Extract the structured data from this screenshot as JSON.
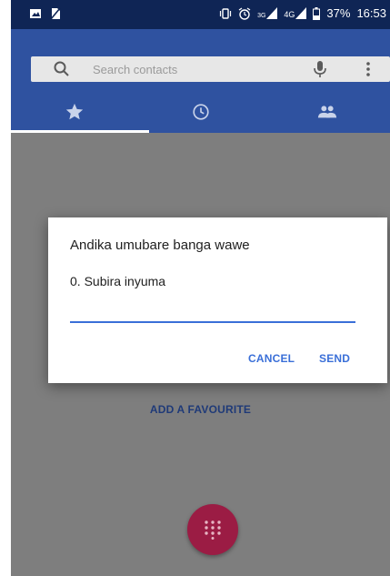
{
  "status_bar": {
    "battery": "37%",
    "time": "16:53",
    "network_3g": "3G",
    "network_4g": "4G",
    "left_icons": [
      "image-notification-icon",
      "no-sim-icon"
    ],
    "right_icons": [
      "vibrate-icon",
      "alarm-icon",
      "signal-3g-icon",
      "signal-4g-icon",
      "battery-icon"
    ]
  },
  "search": {
    "placeholder": "Search contacts",
    "mic_icon": "mic-icon",
    "more_icon": "more-vert-icon"
  },
  "tabs": [
    {
      "name": "favourites",
      "icon": "star-icon",
      "selected": true
    },
    {
      "name": "recents",
      "icon": "clock-icon",
      "selected": false
    },
    {
      "name": "contacts",
      "icon": "people-icon",
      "selected": false
    }
  ],
  "main": {
    "add_favourite_label": "ADD A FAVOURITE",
    "fab_icon": "dialpad-icon"
  },
  "dialog": {
    "title": "Andika umubare banga wawe",
    "message": "0. Subira inyuma",
    "input_value": "",
    "cancel_label": "CANCEL",
    "send_label": "SEND"
  },
  "colors": {
    "status_bar": "#0f2555",
    "toolbar": "#2f52a0",
    "accent": "#3a6fd8",
    "fab": "#9b1c44",
    "scrim": "#7e7e7e"
  }
}
